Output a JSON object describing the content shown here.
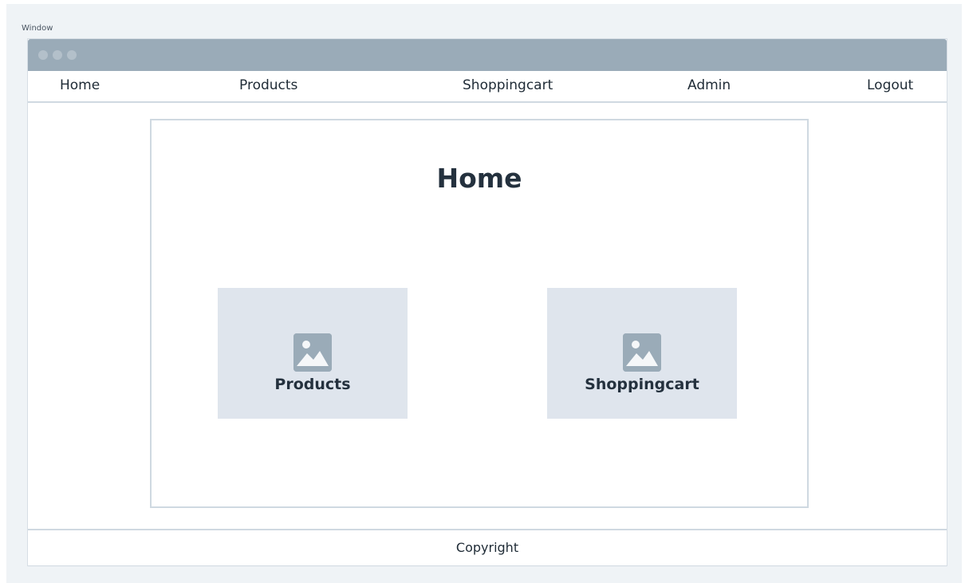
{
  "window": {
    "caption": "Window",
    "titlebar_color": "#9aabb8"
  },
  "nav": {
    "items": [
      {
        "label": "Home"
      },
      {
        "label": "Products"
      },
      {
        "label": "Shoppingcart"
      },
      {
        "label": "Admin"
      },
      {
        "label": "Logout"
      }
    ]
  },
  "main": {
    "title": "Home",
    "cards": [
      {
        "label": "Products",
        "icon": "image-placeholder-icon"
      },
      {
        "label": "Shoppingcart",
        "icon": "image-placeholder-icon"
      }
    ]
  },
  "footer": {
    "text": "Copyright"
  },
  "colors": {
    "background": "#eff3f6",
    "card": "#dfe5ed",
    "border": "#cfd9e1",
    "text": "#24313e"
  }
}
